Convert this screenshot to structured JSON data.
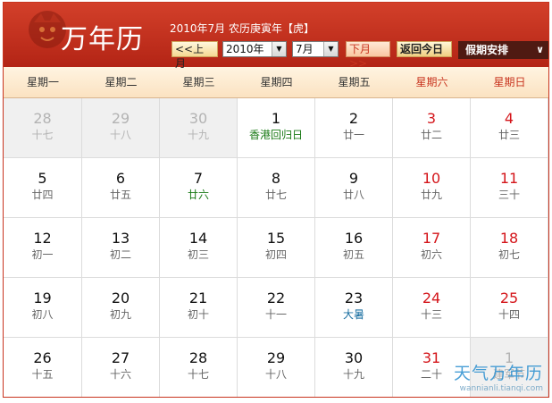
{
  "header": {
    "logo_text": "万年历",
    "lunar_title": "2010年7月 农历庚寅年【虎】",
    "prev_month": "<<上月",
    "year_select": "2010年",
    "month_select": "7月",
    "next_month": "下月>>",
    "today_button": "返回今日",
    "holiday_menu": "假期安排"
  },
  "weekdays": [
    {
      "label": "星期一",
      "weekend": false
    },
    {
      "label": "星期二",
      "weekend": false
    },
    {
      "label": "星期三",
      "weekend": false
    },
    {
      "label": "星期四",
      "weekend": false
    },
    {
      "label": "星期五",
      "weekend": false
    },
    {
      "label": "星期六",
      "weekend": true
    },
    {
      "label": "星期日",
      "weekend": true
    }
  ],
  "weeks": [
    [
      {
        "day": "28",
        "lunar": "十七",
        "other": true
      },
      {
        "day": "29",
        "lunar": "十八",
        "other": true
      },
      {
        "day": "30",
        "lunar": "十九",
        "other": true
      },
      {
        "day": "1",
        "lunar": "香港回归日",
        "style": "fest"
      },
      {
        "day": "2",
        "lunar": "廿一"
      },
      {
        "day": "3",
        "lunar": "廿二",
        "weekend": true
      },
      {
        "day": "4",
        "lunar": "廿三",
        "weekend": true
      }
    ],
    [
      {
        "day": "5",
        "lunar": "廿四"
      },
      {
        "day": "6",
        "lunar": "廿五"
      },
      {
        "day": "7",
        "lunar": "廿六",
        "style": "fest"
      },
      {
        "day": "8",
        "lunar": "廿七"
      },
      {
        "day": "9",
        "lunar": "廿八"
      },
      {
        "day": "10",
        "lunar": "廿九",
        "weekend": true
      },
      {
        "day": "11",
        "lunar": "三十",
        "weekend": true
      }
    ],
    [
      {
        "day": "12",
        "lunar": "初一"
      },
      {
        "day": "13",
        "lunar": "初二"
      },
      {
        "day": "14",
        "lunar": "初三"
      },
      {
        "day": "15",
        "lunar": "初四"
      },
      {
        "day": "16",
        "lunar": "初五"
      },
      {
        "day": "17",
        "lunar": "初六",
        "weekend": true
      },
      {
        "day": "18",
        "lunar": "初七",
        "weekend": true
      }
    ],
    [
      {
        "day": "19",
        "lunar": "初八"
      },
      {
        "day": "20",
        "lunar": "初九"
      },
      {
        "day": "21",
        "lunar": "初十"
      },
      {
        "day": "22",
        "lunar": "十一"
      },
      {
        "day": "23",
        "lunar": "大暑",
        "style": "term"
      },
      {
        "day": "24",
        "lunar": "十三",
        "weekend": true
      },
      {
        "day": "25",
        "lunar": "十四",
        "weekend": true
      }
    ],
    [
      {
        "day": "26",
        "lunar": "十五"
      },
      {
        "day": "27",
        "lunar": "十六"
      },
      {
        "day": "28",
        "lunar": "十七"
      },
      {
        "day": "29",
        "lunar": "十八"
      },
      {
        "day": "30",
        "lunar": "十九"
      },
      {
        "day": "31",
        "lunar": "二十",
        "weekend": true
      },
      {
        "day": "1",
        "lunar": "建军节",
        "other": true
      }
    ]
  ],
  "watermark": {
    "main": "天气万年历",
    "sub": "wannianli.tianqi.com"
  }
}
